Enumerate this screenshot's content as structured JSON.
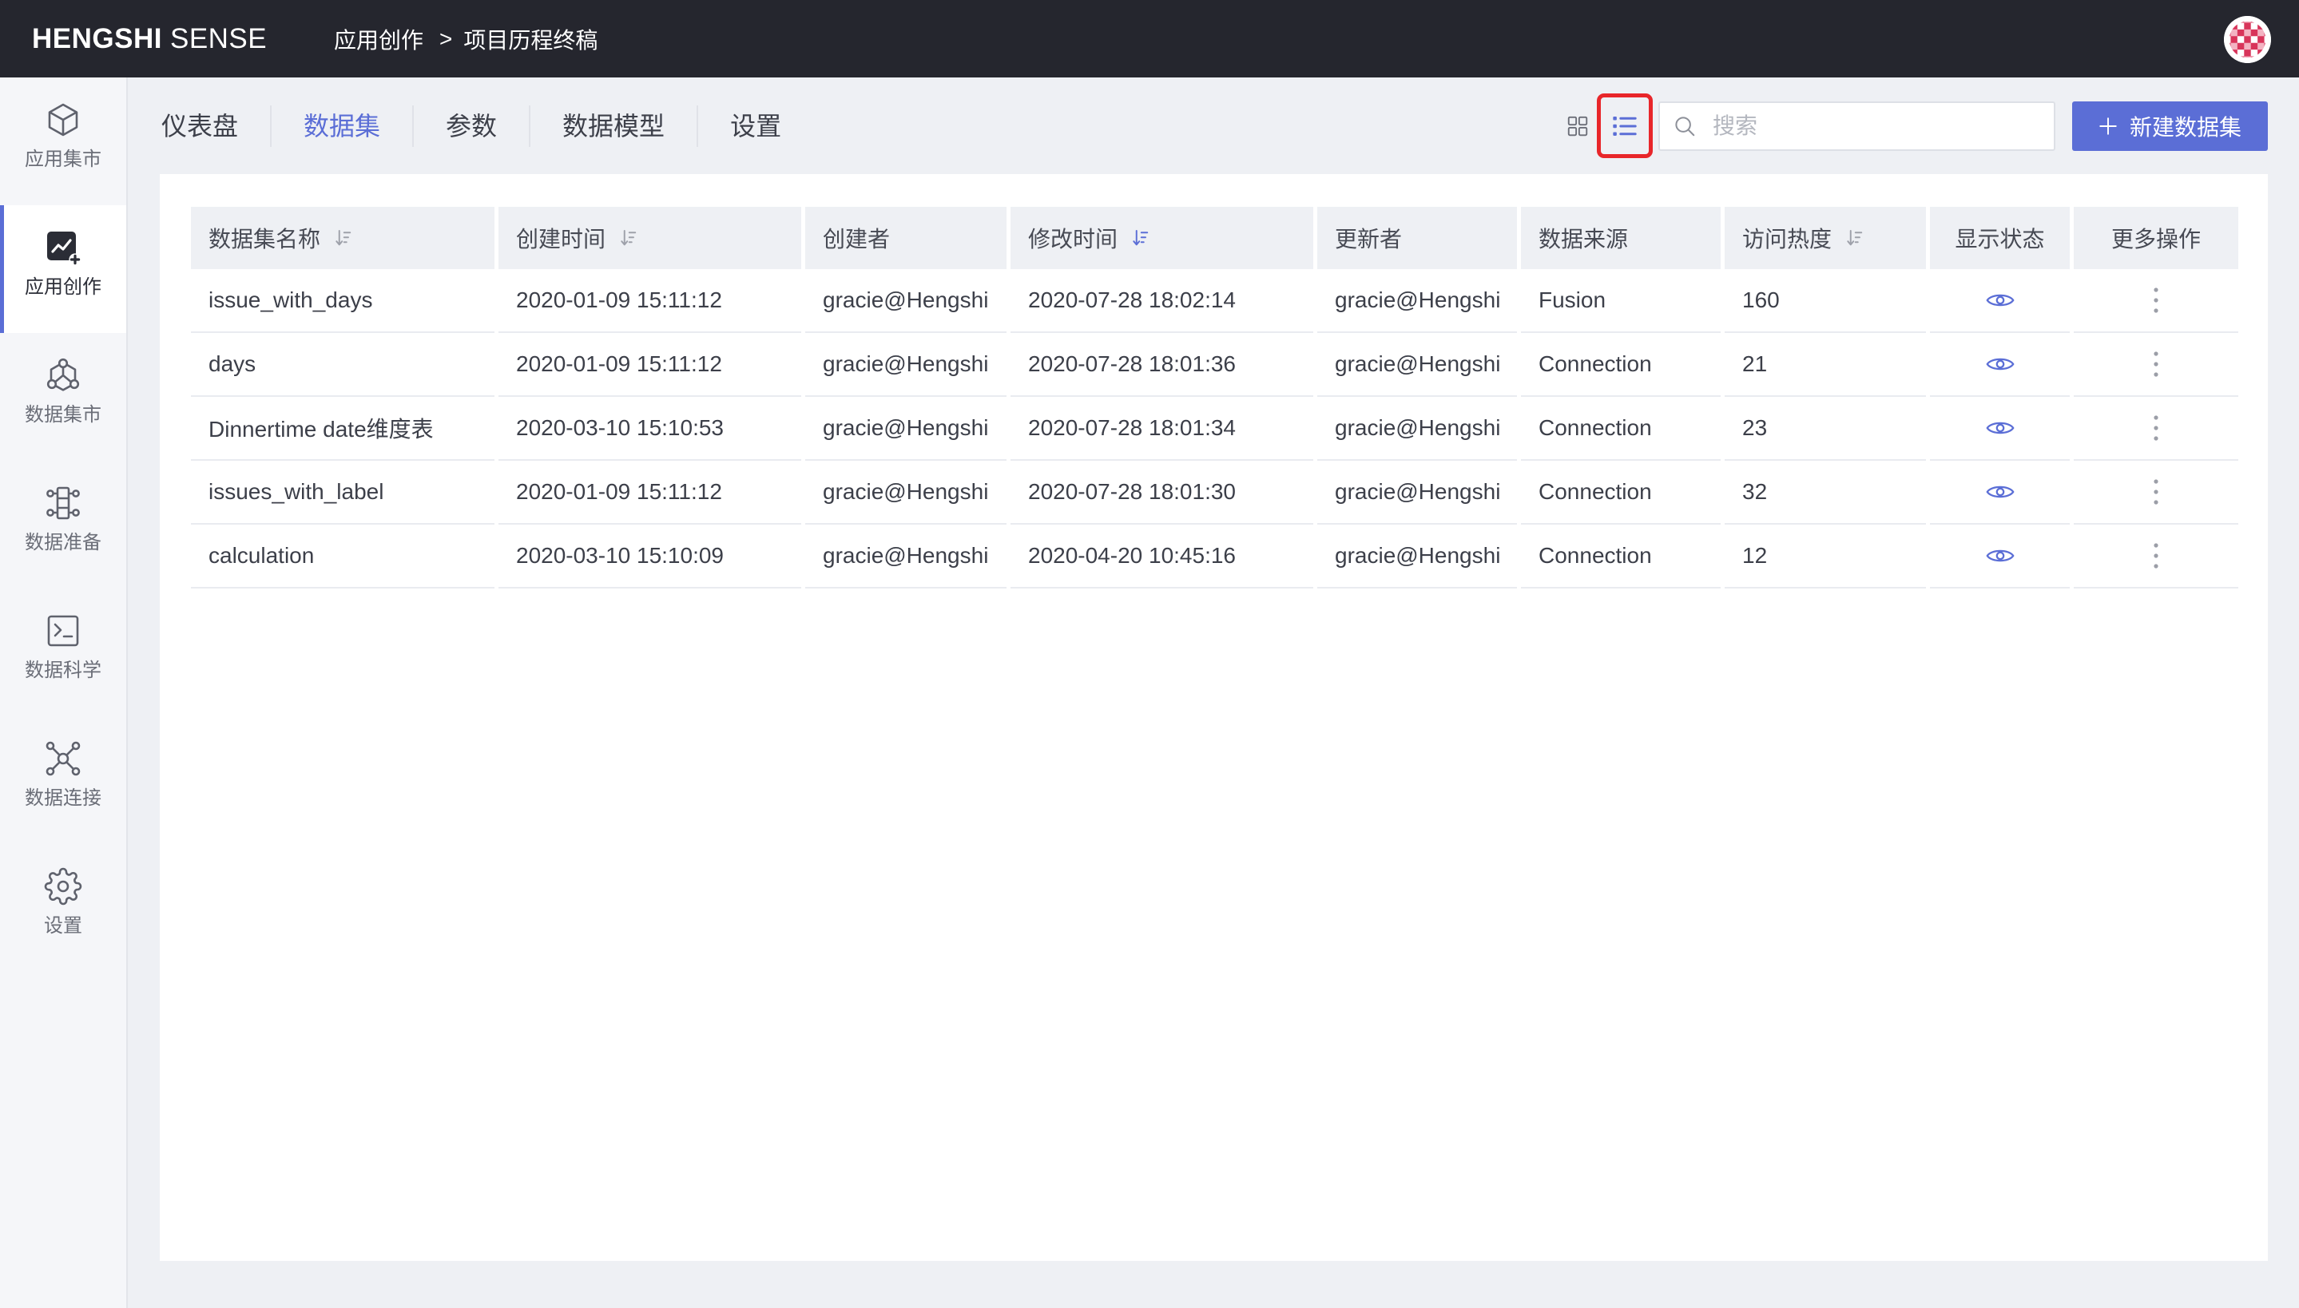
{
  "app": {
    "logo_bold": "HENGSHI",
    "logo_light": "SENSE"
  },
  "breadcrumb": {
    "parent": "应用创作",
    "separator": ">",
    "current": "项目历程终稿"
  },
  "user": {
    "avatar_icon": "identicon-avatar-icon"
  },
  "sidebar": {
    "items": [
      {
        "label": "应用集市",
        "icon": "cube-icon"
      },
      {
        "label": "应用创作",
        "icon": "chart-create-icon",
        "active": true
      },
      {
        "label": "数据集市",
        "icon": "molecule-icon"
      },
      {
        "label": "数据准备",
        "icon": "data-prep-icon"
      },
      {
        "label": "数据科学",
        "icon": "terminal-icon"
      },
      {
        "label": "数据连接",
        "icon": "network-icon"
      },
      {
        "label": "设置",
        "icon": "gear-icon"
      }
    ]
  },
  "tabs": {
    "items": [
      "仪表盘",
      "数据集",
      "参数",
      "数据模型",
      "设置"
    ],
    "active_index": 1
  },
  "toolbar": {
    "grid_view_icon": "grid-view-icon",
    "list_view_icon": "list-view-icon",
    "list_view_active": true,
    "search_icon": "search-icon",
    "search_placeholder": "搜索",
    "new_button_icon": "plus-icon",
    "new_button_label": "新建数据集"
  },
  "table": {
    "columns": [
      {
        "label": "数据集名称",
        "sortable": true,
        "sort_active": false
      },
      {
        "label": "创建时间",
        "sortable": true,
        "sort_active": false
      },
      {
        "label": "创建者",
        "sortable": false
      },
      {
        "label": "修改时间",
        "sortable": true,
        "sort_active": true
      },
      {
        "label": "更新者",
        "sortable": false
      },
      {
        "label": "数据来源",
        "sortable": false
      },
      {
        "label": "访问热度",
        "sortable": true,
        "sort_active": false
      },
      {
        "label": "显示状态",
        "sortable": false
      },
      {
        "label": "更多操作",
        "sortable": false
      }
    ],
    "rows": [
      {
        "name": "issue_with_days",
        "created_at": "2020-01-09 15:11:12",
        "creator": "gracie@Hengshi",
        "modified_at": "2020-07-28 18:02:14",
        "updater": "gracie@Hengshi",
        "source": "Fusion",
        "visits": 160,
        "visible": true
      },
      {
        "name": "days",
        "created_at": "2020-01-09 15:11:12",
        "creator": "gracie@Hengshi",
        "modified_at": "2020-07-28 18:01:36",
        "updater": "gracie@Hengshi",
        "source": "Connection",
        "visits": 21,
        "visible": true
      },
      {
        "name": "Dinnertime date维度表",
        "created_at": "2020-03-10 15:10:53",
        "creator": "gracie@Hengshi",
        "modified_at": "2020-07-28 18:01:34",
        "updater": "gracie@Hengshi",
        "source": "Connection",
        "visits": 23,
        "visible": true
      },
      {
        "name": "issues_with_label",
        "created_at": "2020-01-09 15:11:12",
        "creator": "gracie@Hengshi",
        "modified_at": "2020-07-28 18:01:30",
        "updater": "gracie@Hengshi",
        "source": "Connection",
        "visits": 32,
        "visible": true
      },
      {
        "name": "calculation",
        "created_at": "2020-03-10 15:10:09",
        "creator": "gracie@Hengshi",
        "modified_at": "2020-04-20 10:45:16",
        "updater": "gracie@Hengshi",
        "source": "Connection",
        "visits": 12,
        "visible": true
      }
    ],
    "row_icons": {
      "visibility": "eye-icon",
      "more": "more-vertical-icon"
    }
  },
  "colors": {
    "accent": "#5b6ed6",
    "topbar": "#25262e",
    "highlight": "#e8262a",
    "sort_icon": "#9ea1aa",
    "icon": "#5f626d",
    "muted": "#9b9ea7"
  }
}
